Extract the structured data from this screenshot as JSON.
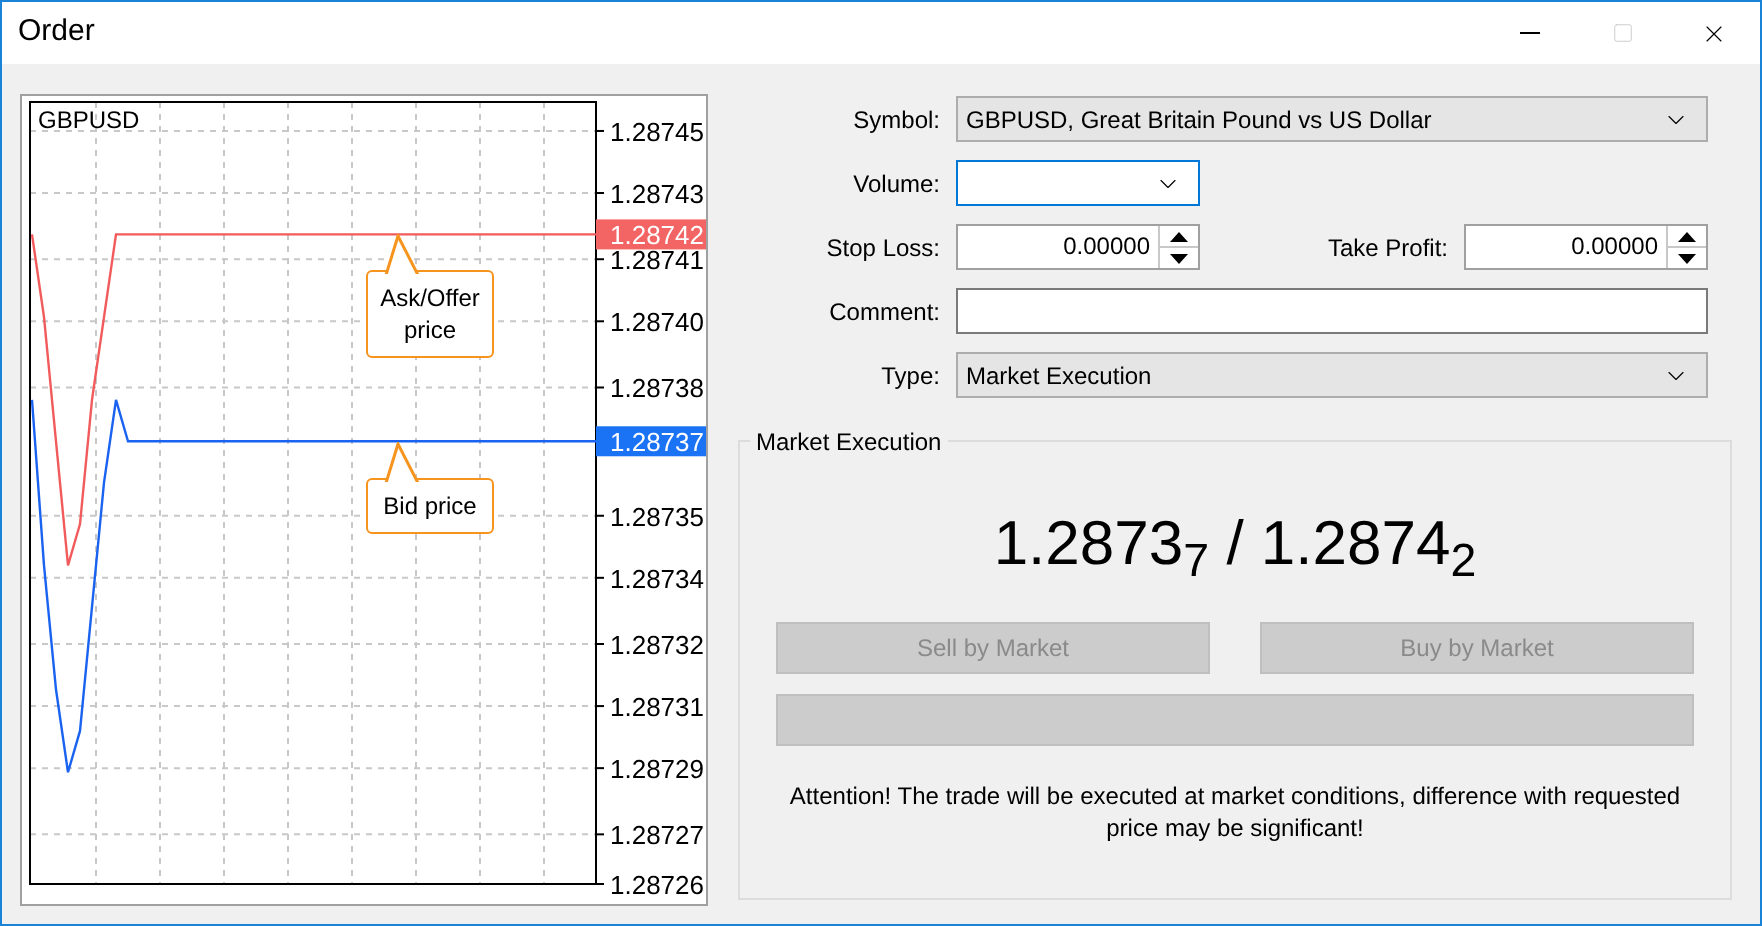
{
  "window": {
    "title": "Order",
    "controls": [
      {
        "kind": "minimize",
        "disabled": false
      },
      {
        "kind": "maximize",
        "disabled": true
      },
      {
        "kind": "close",
        "disabled": false
      }
    ]
  },
  "chart": {
    "chart_data": {
      "type": "line",
      "title": "GBPUSD",
      "grid": true,
      "ylim": [
        1.287263,
        1.287452
      ],
      "categories": [
        null,
        null,
        null,
        null,
        null,
        null,
        null,
        null,
        null,
        null,
        null,
        null,
        null,
        null,
        null,
        null,
        null,
        null,
        null,
        null,
        null,
        null,
        null,
        null,
        null,
        null,
        null,
        null,
        null,
        null,
        null,
        null,
        null,
        null,
        null,
        null,
        null,
        null,
        null,
        null,
        null,
        null,
        null,
        null,
        null,
        null,
        null,
        null
      ],
      "series": [
        {
          "color": "#f25b5b",
          "values": [
            1.28742,
            1.2874,
            1.28737,
            1.28734,
            1.28735,
            1.28738,
            1.2874,
            1.28742,
            1.28742,
            1.28742,
            1.28742,
            1.28742,
            1.28742,
            1.28742,
            1.28742,
            1.28742,
            1.28742,
            1.28742,
            1.28742,
            1.28742,
            1.28742,
            1.28742,
            1.28742,
            1.28742,
            1.28742,
            1.28742,
            1.28742,
            1.28742,
            1.28742,
            1.28742,
            1.28742,
            1.28742,
            1.28742,
            1.28742,
            1.28742,
            1.28742,
            1.28742,
            1.28742,
            1.28742,
            1.28742,
            1.28742,
            1.28742,
            1.28742,
            1.28742,
            1.28742,
            1.28742,
            1.28742,
            1.28742
          ]
        },
        {
          "color": "#1a62f0",
          "values": [
            1.28738,
            1.28734,
            1.28731,
            1.28729,
            1.2873,
            1.28733,
            1.28736,
            1.28738,
            1.28737,
            1.28737,
            1.28737,
            1.28737,
            1.28737,
            1.28737,
            1.28737,
            1.28737,
            1.28737,
            1.28737,
            1.28737,
            1.28737,
            1.28737,
            1.28737,
            1.28737,
            1.28737,
            1.28737,
            1.28737,
            1.28737,
            1.28737,
            1.28737,
            1.28737,
            1.28737,
            1.28737,
            1.28737,
            1.28737,
            1.28737,
            1.28737,
            1.28737,
            1.28737,
            1.28737,
            1.28737,
            1.28737,
            1.28737,
            1.28737,
            1.28737,
            1.28737,
            1.28737,
            1.28737,
            1.28737
          ]
        }
      ],
      "yticks": [
        {
          "value": 1.287445,
          "label": "1.28745"
        },
        {
          "value": 1.28743,
          "label": "1.28743"
        },
        {
          "value": 1.287414,
          "label": "1.28741"
        },
        {
          "value": 1.287399,
          "label": "1.28740"
        },
        {
          "value": 1.287383,
          "label": "1.28738"
        },
        {
          "value": 1.287352,
          "label": "1.28735"
        },
        {
          "value": 1.287337,
          "label": "1.28734"
        },
        {
          "value": 1.287321,
          "label": "1.28732"
        },
        {
          "value": 1.287306,
          "label": "1.28731"
        },
        {
          "value": 1.287291,
          "label": "1.28729"
        },
        {
          "value": 1.287275,
          "label": "1.28727"
        },
        {
          "value": 1.287263,
          "label": "1.28726"
        }
      ]
    },
    "price_tags": [
      {
        "text": "1.28742",
        "color": "#f36464"
      },
      {
        "text": "1.28737",
        "color": "#1a72f5"
      }
    ],
    "callouts": [
      {
        "text": "Ask/Offer price"
      },
      {
        "text": "Bid price"
      }
    ]
  },
  "form": {
    "symbol": {
      "label": "Symbol:",
      "value": "GBPUSD, Great Britain Pound vs US Dollar"
    },
    "volume": {
      "label": "Volume:",
      "focused": true
    },
    "stop_loss": {
      "label": "Stop Loss:",
      "value": "0.00000"
    },
    "take_profit": {
      "label": "Take Profit:",
      "value": "0.00000"
    },
    "comment": {
      "label": "Comment:"
    },
    "type": {
      "label": "Type:",
      "value": "Market Execution"
    }
  },
  "execution": {
    "title": "Market Execution",
    "quote": "1.2873$_{7}$ / 1.2874$_{2}$",
    "buttons": [
      {
        "label": "Sell by Market",
        "disabled": true
      },
      {
        "label": "Buy by Market",
        "disabled": true
      }
    ],
    "bar": {
      "disabled": true
    },
    "notice": "Attention! The trade will be executed at market conditions, difference with requested price may be significant!"
  }
}
